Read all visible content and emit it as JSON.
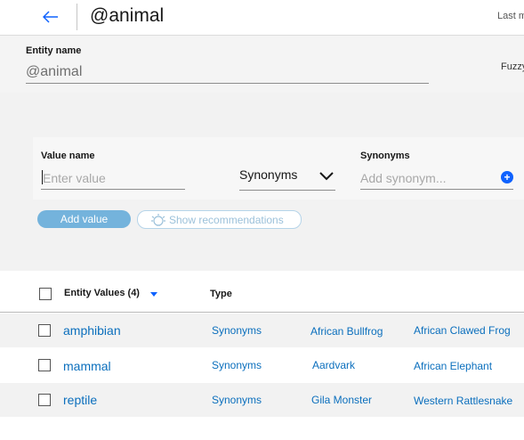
{
  "header": {
    "title": "@animal",
    "last_modified_label": "Last m"
  },
  "entity": {
    "label": "Entity name",
    "value": "@animal",
    "fuzzy_label": "Fuzzy"
  },
  "add_value_form": {
    "value_label": "Value name",
    "value_placeholder": "Enter value",
    "type_selected": "Synonyms",
    "synonyms_label": "Synonyms",
    "synonyms_placeholder": "Add synonym...",
    "add_value_button": "Add value",
    "show_recommendations_button": "Show recommendations"
  },
  "table": {
    "headers": {
      "values": "Entity Values (4)",
      "type": "Type"
    },
    "rows": [
      {
        "value": "amphibian",
        "type": "Synonyms",
        "syn1": "African Bullfrog",
        "syn2": "African Clawed Frog"
      },
      {
        "value": "mammal",
        "type": "Synonyms",
        "syn1": "Aardvark",
        "syn2": "African Elephant"
      },
      {
        "value": "reptile",
        "type": "Synonyms",
        "syn1": "Gila Monster",
        "syn2": "Western Rattlesnake"
      }
    ]
  },
  "colors": {
    "link": "#0b6fbd",
    "primary_button": "#74b3dc",
    "accent": "#0f62fe"
  },
  "icons": {
    "back": "arrow-left-icon",
    "chevron": "chevron-down-icon",
    "add": "plus-circle-icon",
    "recommendations": "lightbulb-icon",
    "sort": "caret-down-icon"
  }
}
